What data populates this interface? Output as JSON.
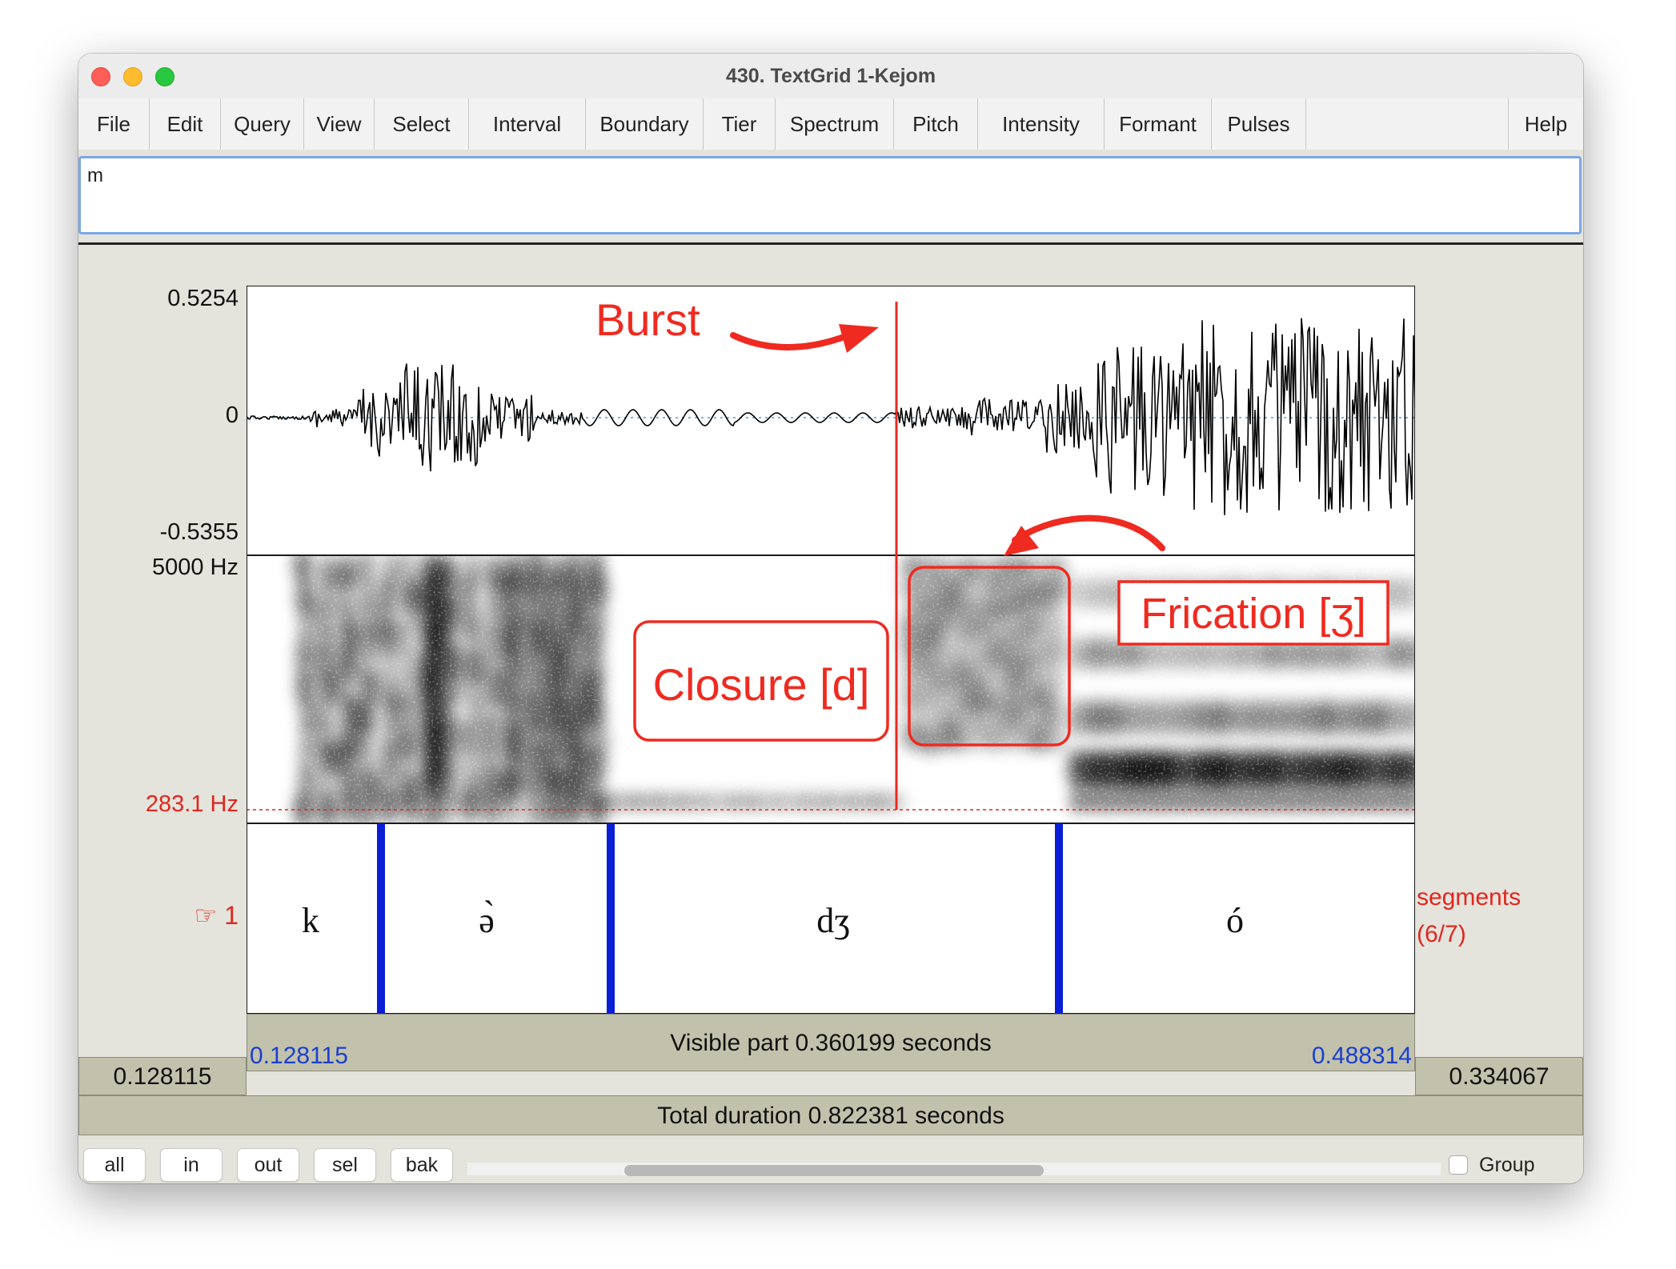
{
  "window": {
    "title": "430. TextGrid 1-Kejom"
  },
  "menu": [
    "File",
    "Edit",
    "Query",
    "View",
    "Select",
    "Interval",
    "Boundary",
    "Tier",
    "Spectrum",
    "Pitch",
    "Intensity",
    "Formant",
    "Pulses"
  ],
  "help_label": "Help",
  "text_field": {
    "value": "m"
  },
  "waveform": {
    "max_label": "0.5254",
    "zero_label": "0",
    "min_label": "-0.5355"
  },
  "spectrogram": {
    "top_label": "5000 Hz",
    "bottom_label": "283.1 Hz"
  },
  "annotations": {
    "burst": "Burst",
    "closure": "Closure [d]",
    "frication": "Frication [ʒ]"
  },
  "tier": {
    "number": "☞ 1",
    "name": "segments",
    "count": "(6/7)",
    "intervals": [
      "k",
      "ə̀",
      "dʒ",
      "ó"
    ]
  },
  "time_bar": {
    "left_time": "0.128115",
    "visible": "Visible part 0.360199 seconds",
    "right_time": "0.488314",
    "left_box": "0.128115",
    "right_box": "0.334067",
    "total": "Total duration 0.822381 seconds"
  },
  "zoom_buttons": [
    "all",
    "in",
    "out",
    "sel",
    "bak"
  ],
  "group_label": "Group",
  "colors": {
    "annotation": "#ef2a20",
    "boundary": "#0a1ed6",
    "time_blue": "#1a3fd0",
    "bar": "#c2c2ac"
  }
}
